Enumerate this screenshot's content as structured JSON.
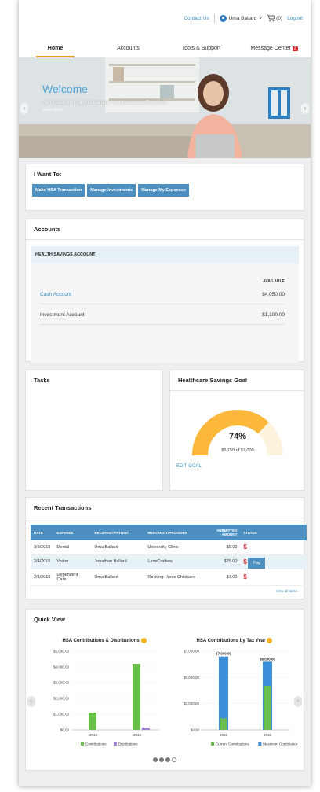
{
  "header": {
    "contact_label": "Contact Us",
    "user_name": "Uma Ballard",
    "user_caret": "˅",
    "cart_count": "(0)",
    "logout_label": "Logout"
  },
  "nav": {
    "tabs": [
      {
        "label": "Home"
      },
      {
        "label": "Accounts"
      },
      {
        "label": "Tools & Support"
      },
      {
        "label": "Message Center",
        "badge": "2"
      }
    ]
  },
  "hero": {
    "welcome": "Welcome",
    "tagline": "We're Making It Easy to Manage Your Healthcare Expenses",
    "learn_more": "Learn More"
  },
  "i_want_to": {
    "title": "I Want To:",
    "buttons": [
      "Make HSA Transaction",
      "Manage Investments",
      "Manage My Expenses"
    ]
  },
  "accounts": {
    "title": "Accounts",
    "section_header": "HEALTH SAVINGS ACCOUNT",
    "available_label": "AVAILABLE",
    "rows": [
      {
        "name": "Cash Account",
        "amount": "$4,050.00"
      },
      {
        "name": "Investment Account",
        "amount": "$1,100.00"
      }
    ]
  },
  "tasks": {
    "title": "Tasks"
  },
  "goal": {
    "title": "Healthcare Savings Goal",
    "percent_label": "74%",
    "percent": 74,
    "amount_text": "$5,150 of $7,000",
    "edit_label": "EDIT GOAL",
    "colors": {
      "fill": "#fbb83a",
      "track": "#fdf3dc"
    }
  },
  "transactions": {
    "title": "Recent Transactions",
    "headers": [
      "DATE",
      "EXPENSE",
      "RECIPIENT/PATIENT",
      "MERCHANT/PROVIDER",
      "SUBMITTED AMOUNT",
      "STATUS"
    ],
    "rows": [
      {
        "date": "3/2/2015",
        "expense": "Dental",
        "recipient": "Uma Ballard",
        "merchant": "University Clinic",
        "amount": "$9.00",
        "status": "$",
        "action": ""
      },
      {
        "date": "2/4/2015",
        "expense": "Vision",
        "recipient": "Jonathan Ballard",
        "merchant": "LensCrafters",
        "amount": "$25.00",
        "status": "$",
        "action": "Pay"
      },
      {
        "date": "2/1/2015",
        "expense": "Dependent Care",
        "recipient": "Uma Ballard",
        "merchant": "Rocking Horse Childcare",
        "amount": "$7.00",
        "status": "$",
        "action": ""
      }
    ],
    "view_all": "View all tasks"
  },
  "quick_view": {
    "title": "Quick View",
    "carousel_dots": 4,
    "carousel_active": 2
  },
  "chart_data": [
    {
      "type": "bar",
      "title": "HSA Contributions & Distributions",
      "categories": [
        "2015",
        "2016"
      ],
      "series": [
        {
          "name": "Contributions",
          "color": "#6abf4b",
          "values": [
            1100,
            4200
          ]
        },
        {
          "name": "Distributions",
          "color": "#9b7fd4",
          "values": [
            0,
            150
          ]
        }
      ],
      "ylim": [
        0,
        5000
      ],
      "yticks": [
        "$5,000.00",
        "$4,000.00",
        "$3,000.00",
        "$2,000.00",
        "$1,000.00",
        "$0.00"
      ]
    },
    {
      "type": "bar",
      "title": "HSA Contributions by Tax Year",
      "categories": [
        "2015",
        "2016"
      ],
      "series": [
        {
          "name": "Current Contributions",
          "color": "#6abf4b",
          "values": [
            1100,
            4200
          ]
        },
        {
          "name": "Maximum Contribution",
          "color": "#3a8fd8",
          "values": [
            7000,
            6500
          ]
        }
      ],
      "data_labels": [
        "$7,000.00",
        "$6,500.00"
      ],
      "ylim": [
        0,
        7500
      ],
      "yticks": [
        "$7,500.00",
        "$5,000.00",
        "$2,500.00",
        "$0.00"
      ]
    }
  ]
}
